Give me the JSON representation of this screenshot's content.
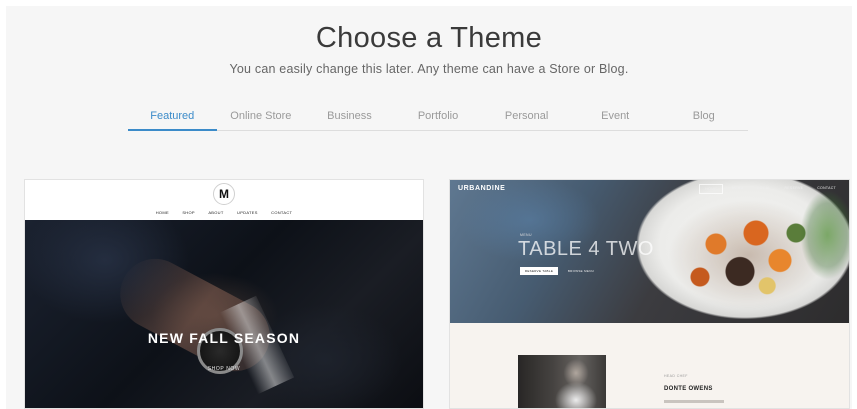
{
  "header": {
    "title": "Choose a Theme",
    "subtitle": "You can easily change this later. Any theme can have a Store or Blog."
  },
  "tabs": [
    {
      "label": "Featured",
      "active": true
    },
    {
      "label": "Online Store",
      "active": false
    },
    {
      "label": "Business",
      "active": false
    },
    {
      "label": "Portfolio",
      "active": false
    },
    {
      "label": "Personal",
      "active": false
    },
    {
      "label": "Event",
      "active": false
    },
    {
      "label": "Blog",
      "active": false
    }
  ],
  "colors": {
    "accent": "#3b8bc9",
    "background": "#f6f6f6"
  },
  "themes": [
    {
      "logo": "M",
      "nav": [
        "HOME",
        "SHOP",
        "ABOUT",
        "UPDATES",
        "CONTACT"
      ],
      "headline": "NEW FALL SEASON",
      "cta": "SHOP NOW"
    },
    {
      "brand": "URBANDINE",
      "nav": [
        "HOME",
        "MENU",
        "LOCAL",
        "RESERVE",
        "CONTACT"
      ],
      "kicker": "MENU",
      "headline": "TABLE 4 TWO",
      "button_primary": "RESERVE TABLE",
      "button_secondary": "BROWSE MENU",
      "section_kicker": "HEAD CHEF",
      "section_name": "DONTE OWENS"
    }
  ]
}
